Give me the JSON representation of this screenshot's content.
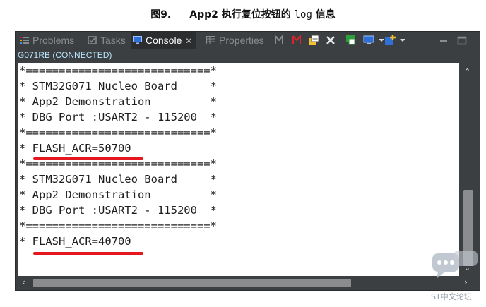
{
  "caption": {
    "figure": "图9.",
    "text_before": "App2 执行复位按钮的 ",
    "text_mono": "log",
    "text_after": " 信息"
  },
  "tabs": [
    {
      "label": "Problems",
      "icon": "problems-icon",
      "active": false
    },
    {
      "label": "Tasks",
      "icon": "tasks-icon",
      "active": false
    },
    {
      "label": "Console",
      "icon": "console-icon",
      "active": true
    },
    {
      "label": "Properties",
      "icon": "properties-icon",
      "active": false
    }
  ],
  "console_close": "✕",
  "toolbar_icons": [
    "scroll-lock-icon",
    "terminate-icon",
    "clear-console-icon",
    "remove-launch-icon",
    "pin-console-icon",
    "display-console-icon",
    "new-console-icon",
    "minimize-icon",
    "maximize-icon"
  ],
  "status": "G071RB (CONNECTED)",
  "console_lines": [
    "*============================*",
    "* STM32G071 Nucleo Board     *",
    "* App2 Demonstration         *",
    "* DBG Port :USART2 - 115200  *",
    "*============================*",
    "* FLASH_ACR=50700",
    "*============================*",
    "* STM32G071 Nucleo Board     *",
    "* App2 Demonstration         *",
    "* DBG Port :USART2 - 115200  *",
    "*============================*",
    "* FLASH_ACR=40700"
  ],
  "watermark": "ST中文论坛",
  "colors": {
    "panel": "#3c3f41",
    "highlight": "#e5161d",
    "status_text": "#b9e6ff"
  }
}
